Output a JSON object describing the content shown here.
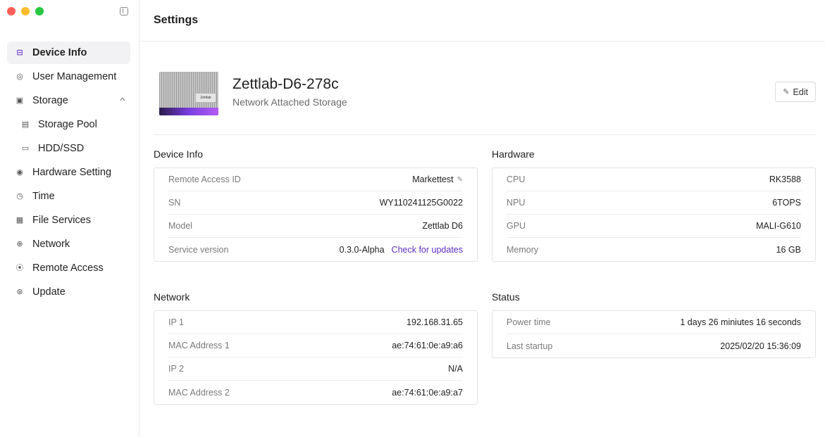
{
  "sidebar": {
    "items": [
      {
        "label": "Device Info",
        "icon": "device-icon",
        "glyph": "⊟"
      },
      {
        "label": "User Management",
        "icon": "user-icon",
        "glyph": "◎"
      },
      {
        "label": "Storage",
        "icon": "storage-icon",
        "glyph": "▣"
      },
      {
        "label": "Storage Pool",
        "icon": "storage-pool-icon",
        "glyph": "▤"
      },
      {
        "label": "HDD/SSD",
        "icon": "disk-icon",
        "glyph": "▭"
      },
      {
        "label": "Hardware Setting",
        "icon": "hardware-icon",
        "glyph": "◉"
      },
      {
        "label": "Time",
        "icon": "clock-icon",
        "glyph": "◷"
      },
      {
        "label": "File Services",
        "icon": "file-icon",
        "glyph": "▦"
      },
      {
        "label": "Network",
        "icon": "network-icon",
        "glyph": "⊕"
      },
      {
        "label": "Remote Access",
        "icon": "antenna-icon",
        "glyph": "⦿"
      },
      {
        "label": "Update",
        "icon": "update-icon",
        "glyph": "⊛"
      }
    ],
    "storage_chevron": "^"
  },
  "header": {
    "title": "Settings"
  },
  "device": {
    "name": "Zettlab-D6-278c",
    "type": "Network Attached Storage",
    "edit_label": "Edit",
    "image_badge": "Zettlab"
  },
  "device_info": {
    "title": "Device Info",
    "rows": [
      {
        "key": "Remote Access ID",
        "value": "Markettest"
      },
      {
        "key": "SN",
        "value": "WY110241125G0022"
      },
      {
        "key": "Model",
        "value": "Zettlab D6"
      },
      {
        "key": "Service version",
        "value": "0.3.0-Alpha",
        "link": "Check for updates"
      }
    ]
  },
  "hardware": {
    "title": "Hardware",
    "rows": [
      {
        "key": "CPU",
        "value": "RK3588"
      },
      {
        "key": "NPU",
        "value": "6TOPS"
      },
      {
        "key": "GPU",
        "value": "MALI-G610"
      },
      {
        "key": "Memory",
        "value": "16 GB"
      }
    ]
  },
  "network": {
    "title": "Network",
    "rows": [
      {
        "key": "IP 1",
        "value": "192.168.31.65"
      },
      {
        "key": "MAC Address 1",
        "value": "ae:74:61:0e:a9:a6"
      },
      {
        "key": "IP 2",
        "value": "N/A"
      },
      {
        "key": "MAC Address 2",
        "value": "ae:74:61:0e:a9:a7"
      }
    ]
  },
  "status": {
    "title": "Status",
    "rows": [
      {
        "key": "Power time",
        "value": "1 days 26 miniutes 16 seconds"
      },
      {
        "key": "Last startup",
        "value": "2025/02/20 15:36:09"
      }
    ]
  },
  "colors": {
    "accent": "#5b2fc1",
    "active_bg": "#f2f2f4"
  }
}
